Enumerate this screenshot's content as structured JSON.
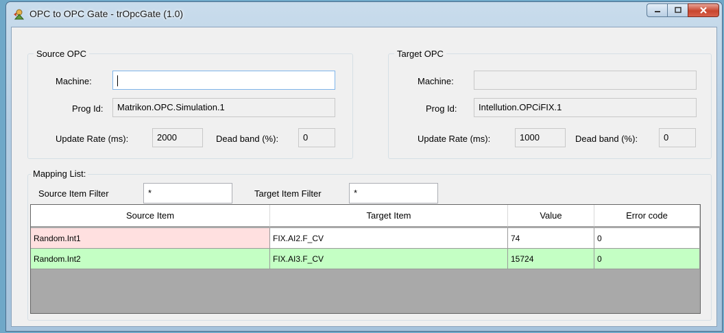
{
  "window": {
    "title": "OPC to OPC Gate - trOpcGate (1.0)",
    "icon": "app-icon",
    "colors": {
      "row_pending": "#ffe0e0",
      "row_ok": "#c4ffc4"
    }
  },
  "source": {
    "legend": "Source OPC",
    "machine_label": "Machine:",
    "machine_value": "",
    "progid_label": "Prog Id:",
    "progid_value": "Matrikon.OPC.Simulation.1",
    "rate_label": "Update Rate (ms):",
    "rate_value": "2000",
    "deadband_label": "Dead band (%):",
    "deadband_value": "0"
  },
  "target": {
    "legend": "Target OPC",
    "machine_label": "Machine:",
    "machine_value": "",
    "progid_label": "Prog Id:",
    "progid_value": "Intellution.OPCiFIX.1",
    "rate_label": "Update Rate (ms):",
    "rate_value": "1000",
    "deadband_label": "Dead band (%):",
    "deadband_value": "0"
  },
  "mapping": {
    "legend": "Mapping List:",
    "source_filter_label": "Source Item Filter",
    "source_filter_value": "*",
    "target_filter_label": "Target Item Filter",
    "target_filter_value": "*",
    "columns": [
      "Source Item",
      "Target Item",
      "Value",
      "Error code"
    ],
    "rows": [
      {
        "source": "Random.Int1",
        "target": "FIX.AI2.F_CV",
        "value": "74",
        "error": "0",
        "status": "pending"
      },
      {
        "source": "Random.Int2",
        "target": "FIX.AI3.F_CV",
        "value": "15724",
        "error": "0",
        "status": "ok"
      }
    ]
  }
}
